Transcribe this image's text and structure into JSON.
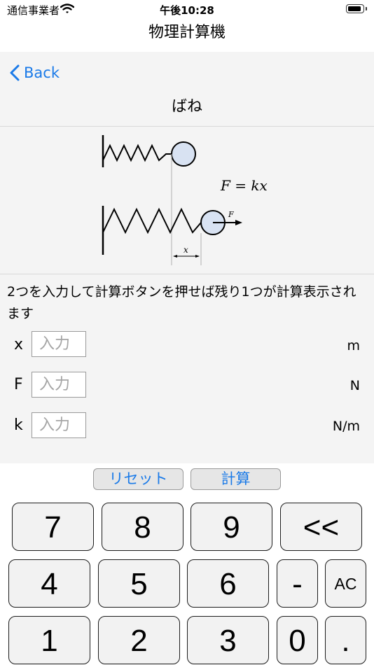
{
  "status_bar": {
    "carrier": "通信事業者",
    "time": "午後10:28",
    "battery_level": 0.95
  },
  "app_title": "物理計算機",
  "nav": {
    "back_label": "Back",
    "screen_title": "ばね"
  },
  "diagram": {
    "formula": "F = kx",
    "force_label": "F",
    "displacement_label": "x"
  },
  "instruction": "2つを入力して計算ボタンを押せば残り1つが計算表示されます",
  "fields": [
    {
      "label": "x",
      "placeholder": "入力",
      "value": "",
      "unit": "m"
    },
    {
      "label": "F",
      "placeholder": "入力",
      "value": "",
      "unit": "N"
    },
    {
      "label": "k",
      "placeholder": "入力",
      "value": "",
      "unit": "N/m"
    }
  ],
  "actions": {
    "reset_label": "リセット",
    "calculate_label": "計算"
  },
  "keypad": {
    "row1": [
      "7",
      "8",
      "9",
      "<<"
    ],
    "row2": [
      "4",
      "5",
      "6",
      "-",
      "AC"
    ],
    "row3": [
      "1",
      "2",
      "3",
      "0",
      "."
    ]
  },
  "colors": {
    "accent": "#1a7ae8",
    "panel_bg": "#f4f4f4",
    "ball_fill": "#d8e2f2",
    "key_bg": "#f2f2f2"
  }
}
